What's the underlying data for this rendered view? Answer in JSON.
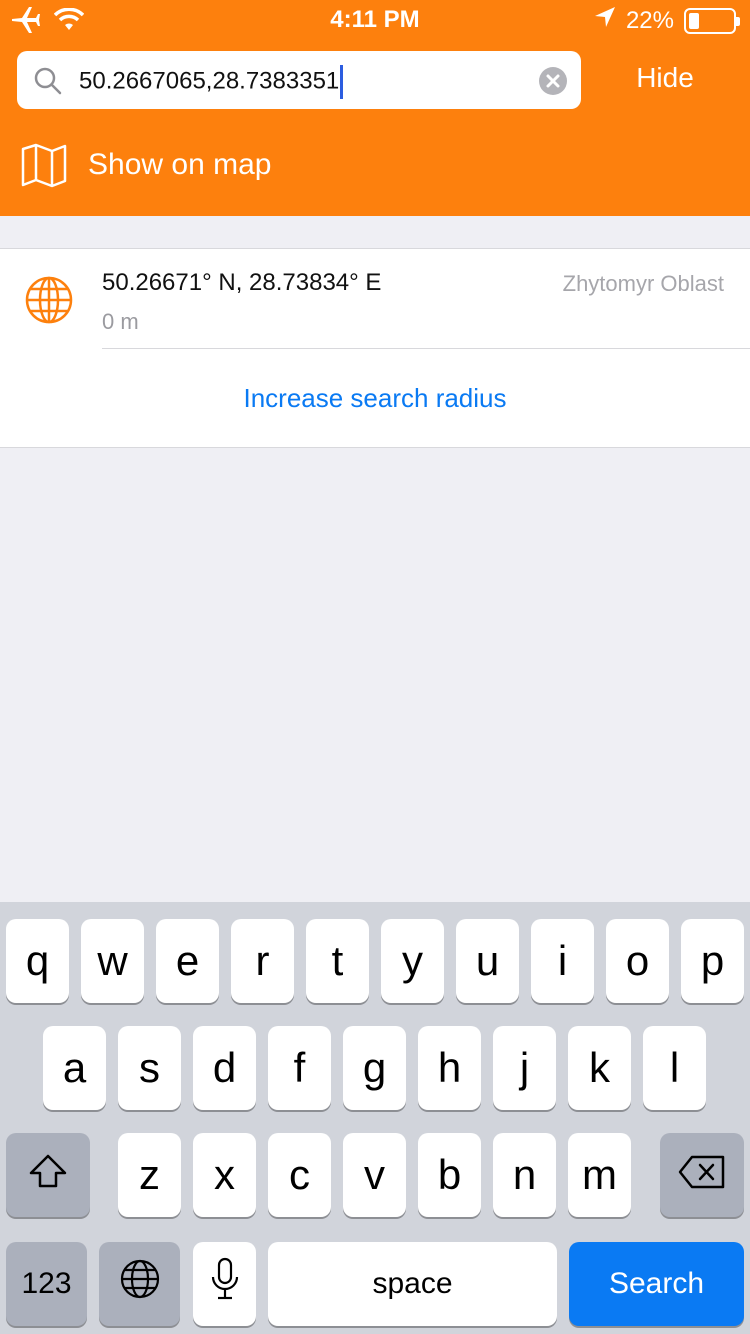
{
  "status_bar": {
    "time": "4:11 PM",
    "battery_percent": "22%",
    "battery_level": 0.22
  },
  "search": {
    "value": "50.2667065,28.7383351",
    "hide_label": "Hide"
  },
  "show_on_map": {
    "label": "Show on map"
  },
  "results": {
    "items": [
      {
        "coords": "50.26671° N, 28.73834° E",
        "distance": "0 m",
        "region": "Zhytomyr Oblast"
      }
    ],
    "increase_radius_label": "Increase search radius"
  },
  "keyboard": {
    "row1": [
      "q",
      "w",
      "e",
      "r",
      "t",
      "y",
      "u",
      "i",
      "o",
      "p"
    ],
    "row2": [
      "a",
      "s",
      "d",
      "f",
      "g",
      "h",
      "j",
      "k",
      "l"
    ],
    "row3": [
      "z",
      "x",
      "c",
      "v",
      "b",
      "n",
      "m"
    ],
    "numbers_label": "123",
    "space_label": "space",
    "search_label": "Search"
  },
  "colors": {
    "header": "#fd800d",
    "accent": "#0a7af3",
    "keyboard_bg": "#d1d4db"
  }
}
